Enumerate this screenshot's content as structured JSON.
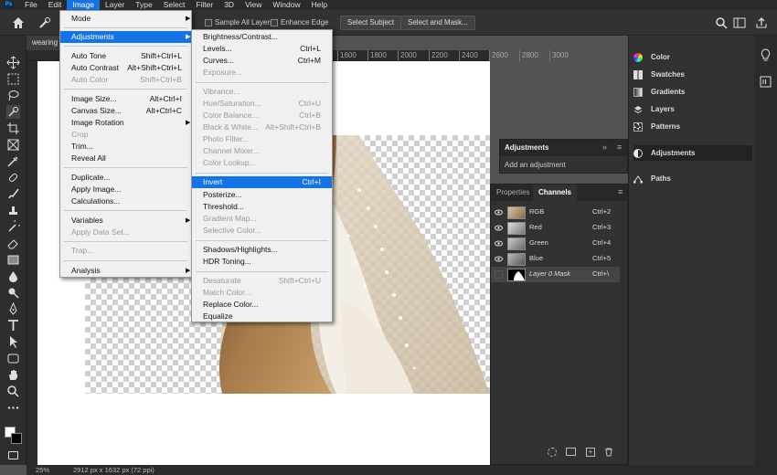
{
  "menubar": {
    "items": [
      "File",
      "Edit",
      "Image",
      "Layer",
      "Type",
      "Select",
      "Filter",
      "3D",
      "View",
      "Window",
      "Help"
    ],
    "active_index": 2
  },
  "options_bar": {
    "sample_all_layers": "Sample All Layers",
    "enhance_edge": "Enhance Edge",
    "select_subject": "Select Subject",
    "select_and_mask": "Select and Mask..."
  },
  "doc_tab": {
    "title": "wearing"
  },
  "ruler": {
    "ticks": [
      "1600",
      "1800",
      "2000",
      "2200",
      "2400",
      "2600",
      "2800",
      "3000"
    ]
  },
  "image_menu": {
    "items": [
      {
        "label": "Mode",
        "shortcut": "",
        "submenu": true,
        "disabled": false
      },
      {
        "label": "Adjustments",
        "shortcut": "",
        "submenu": true,
        "disabled": false,
        "highlighted": true
      },
      {
        "label": "Auto Tone",
        "shortcut": "Shift+Ctrl+L",
        "disabled": false
      },
      {
        "label": "Auto Contrast",
        "shortcut": "Alt+Shift+Ctrl+L",
        "disabled": false
      },
      {
        "label": "Auto Color",
        "shortcut": "Shift+Ctrl+B",
        "disabled": true
      },
      {
        "label": "Image Size...",
        "shortcut": "Alt+Ctrl+I",
        "disabled": false
      },
      {
        "label": "Canvas Size...",
        "shortcut": "Alt+Ctrl+C",
        "disabled": false
      },
      {
        "label": "Image Rotation",
        "shortcut": "",
        "submenu": true,
        "disabled": false
      },
      {
        "label": "Crop",
        "shortcut": "",
        "disabled": true
      },
      {
        "label": "Trim...",
        "shortcut": "",
        "disabled": false
      },
      {
        "label": "Reveal All",
        "shortcut": "",
        "disabled": false
      },
      {
        "label": "Duplicate...",
        "shortcut": "",
        "disabled": false
      },
      {
        "label": "Apply Image...",
        "shortcut": "",
        "disabled": false
      },
      {
        "label": "Calculations...",
        "shortcut": "",
        "disabled": false
      },
      {
        "label": "Variables",
        "shortcut": "",
        "submenu": true,
        "disabled": false
      },
      {
        "label": "Apply Data Set...",
        "shortcut": "",
        "disabled": true
      },
      {
        "label": "Trap...",
        "shortcut": "",
        "disabled": true
      },
      {
        "label": "Analysis",
        "shortcut": "",
        "submenu": true,
        "disabled": false
      }
    ]
  },
  "adjustments_menu": {
    "items": [
      {
        "label": "Brightness/Contrast...",
        "shortcut": "",
        "disabled": false
      },
      {
        "label": "Levels...",
        "shortcut": "Ctrl+L",
        "disabled": false
      },
      {
        "label": "Curves...",
        "shortcut": "Ctrl+M",
        "disabled": false
      },
      {
        "label": "Exposure...",
        "shortcut": "",
        "disabled": true
      },
      {
        "label": "Vibrance...",
        "shortcut": "",
        "disabled": true
      },
      {
        "label": "Hue/Saturation...",
        "shortcut": "Ctrl+U",
        "disabled": true
      },
      {
        "label": "Color Balance...",
        "shortcut": "Ctrl+B",
        "disabled": true
      },
      {
        "label": "Black & White...",
        "shortcut": "Alt+Shift+Ctrl+B",
        "disabled": true
      },
      {
        "label": "Photo Filter...",
        "shortcut": "",
        "disabled": true
      },
      {
        "label": "Channel Mixer...",
        "shortcut": "",
        "disabled": true
      },
      {
        "label": "Color Lookup...",
        "shortcut": "",
        "disabled": true
      },
      {
        "label": "Invert",
        "shortcut": "Ctrl+I",
        "disabled": false,
        "highlighted": true
      },
      {
        "label": "Posterize...",
        "shortcut": "",
        "disabled": false
      },
      {
        "label": "Threshold...",
        "shortcut": "",
        "disabled": false
      },
      {
        "label": "Gradient Map...",
        "shortcut": "",
        "disabled": true
      },
      {
        "label": "Selective Color...",
        "shortcut": "",
        "disabled": true
      },
      {
        "label": "Shadows/Highlights...",
        "shortcut": "",
        "disabled": false
      },
      {
        "label": "HDR Toning...",
        "shortcut": "",
        "disabled": false
      },
      {
        "label": "Desaturate",
        "shortcut": "Shift+Ctrl+U",
        "disabled": true
      },
      {
        "label": "Match Color...",
        "shortcut": "",
        "disabled": true
      },
      {
        "label": "Replace Color...",
        "shortcut": "",
        "disabled": false
      },
      {
        "label": "Equalize",
        "shortcut": "",
        "disabled": false
      }
    ]
  },
  "dock": {
    "items": [
      {
        "label": "Color",
        "icon": "color-wheel-icon"
      },
      {
        "label": "Swatches",
        "icon": "swatches-icon"
      },
      {
        "label": "Gradients",
        "icon": "gradients-icon"
      },
      {
        "label": "Layers",
        "icon": "layers-icon"
      },
      {
        "label": "Patterns",
        "icon": "patterns-icon"
      },
      {
        "label": "Adjustments",
        "icon": "adjustments-icon",
        "active": true
      },
      {
        "label": "Paths",
        "icon": "paths-icon"
      }
    ]
  },
  "adjustments_panel": {
    "title": "Adjustments",
    "subtitle": "Add an adjustment"
  },
  "properties_panel": {
    "tabs": [
      "Properties",
      "Channels"
    ],
    "active_tab": "Channels",
    "channels": [
      {
        "name": "RGB",
        "shortcut": "Ctrl+2",
        "visible": true
      },
      {
        "name": "Red",
        "shortcut": "Ctrl+3",
        "visible": true
      },
      {
        "name": "Green",
        "shortcut": "Ctrl+4",
        "visible": true
      },
      {
        "name": "Blue",
        "shortcut": "Ctrl+5",
        "visible": true
      },
      {
        "name": "Layer 0 Mask",
        "shortcut": "Ctrl+\\",
        "visible": false,
        "selected": true
      }
    ]
  },
  "status": {
    "zoom": "25%",
    "doc_info": "2912 px x 1632 px (72 ppi)"
  },
  "colors": {
    "accent": "#1473e6",
    "panel": "#323232",
    "menu_bg": "#f0f0f0"
  }
}
